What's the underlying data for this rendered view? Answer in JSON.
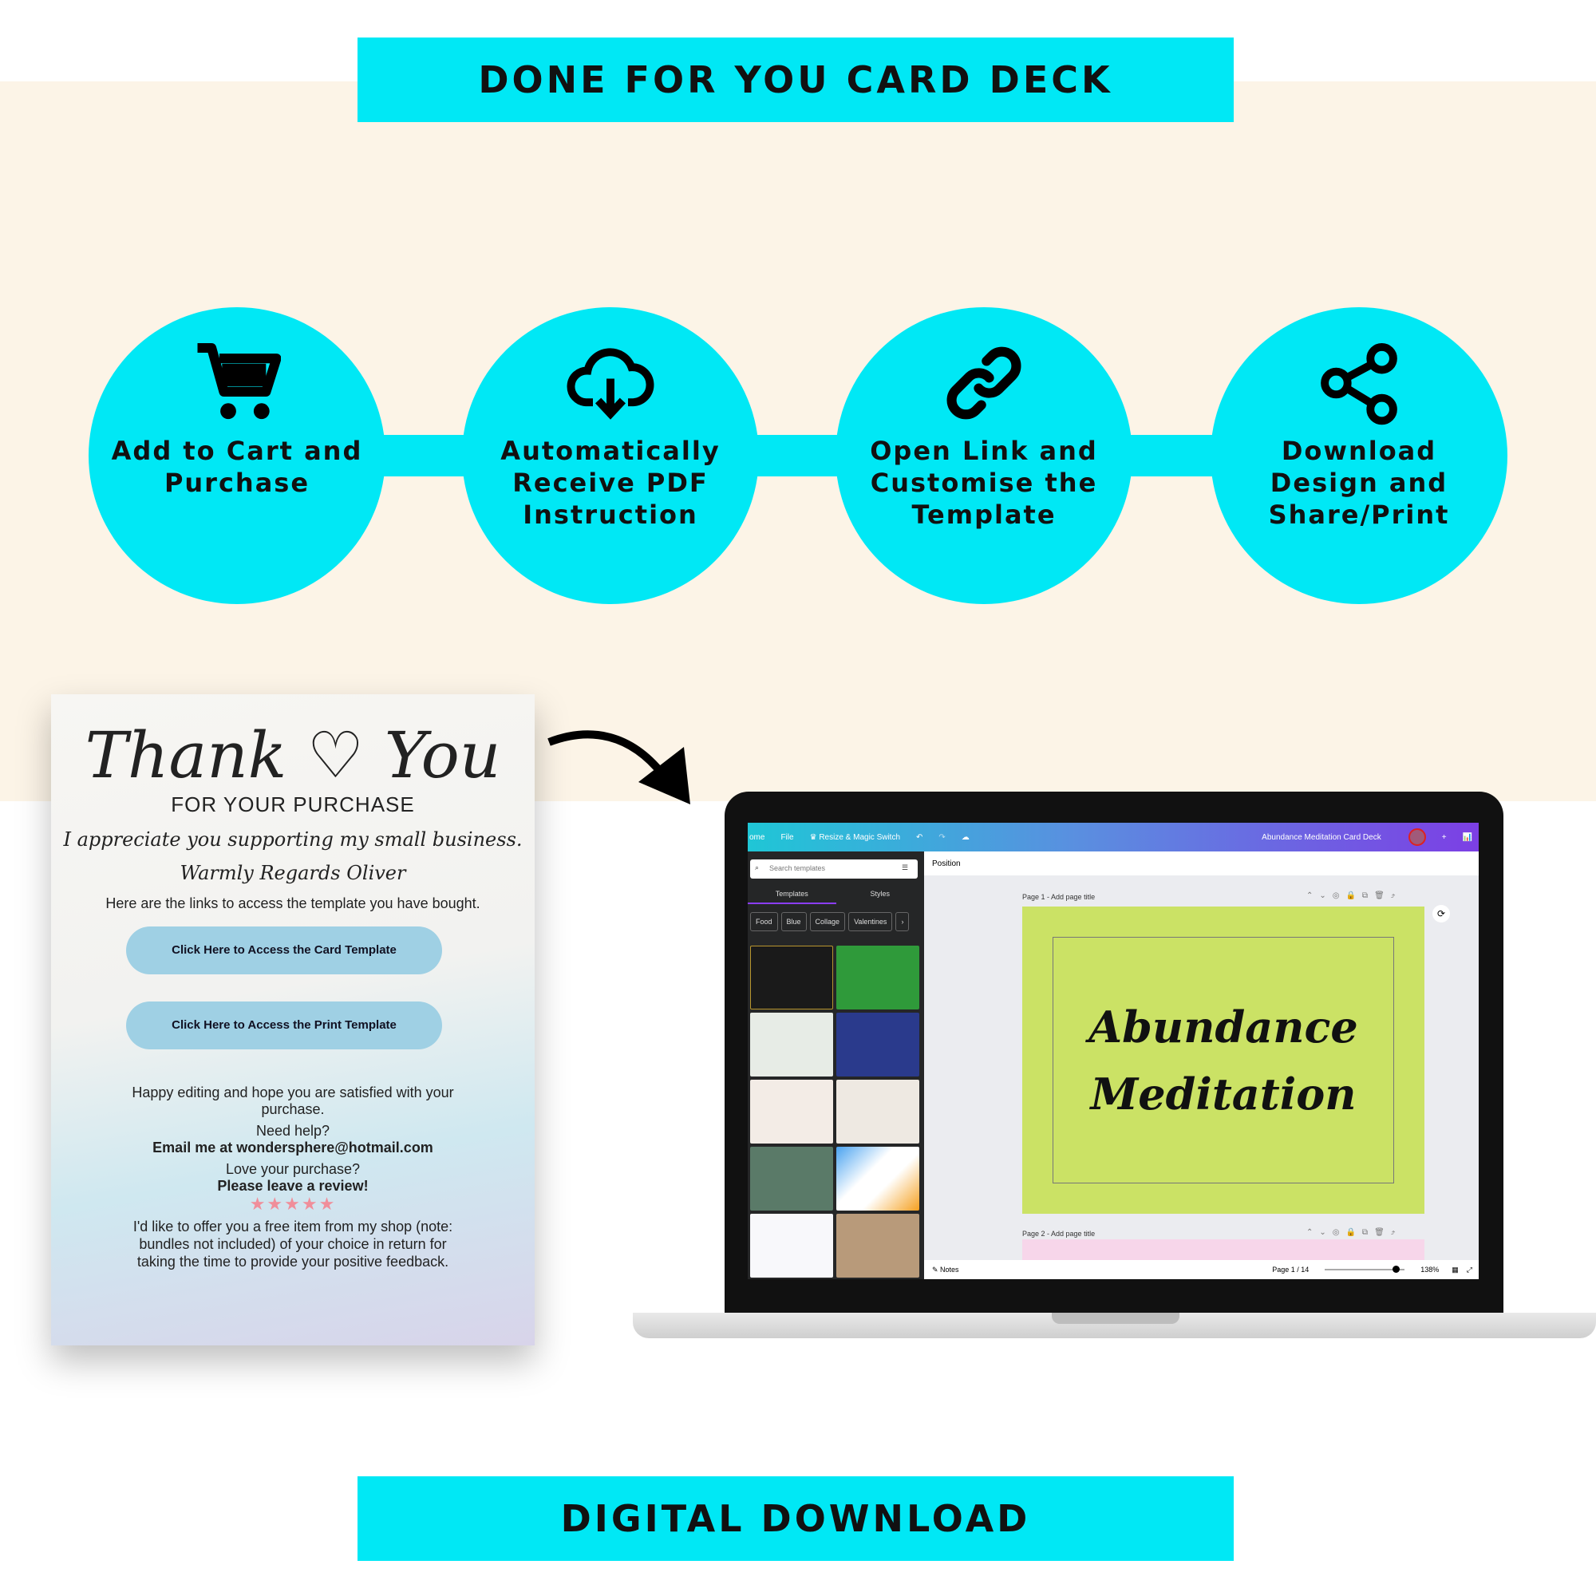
{
  "header": {
    "title": "DONE FOR YOU CARD DECK"
  },
  "steps": [
    {
      "icon": "cart-icon",
      "label": "Add to Cart and Purchase"
    },
    {
      "icon": "cloud-download-icon",
      "label": "Automatically Receive PDF Instruction"
    },
    {
      "icon": "link-icon",
      "label": "Open Link and Customise the Template"
    },
    {
      "icon": "share-icon",
      "label": "Download Design and Share/Print"
    }
  ],
  "card": {
    "title": "Thank ♡ You",
    "subtitle": "FOR YOUR PURCHASE",
    "line1": "I appreciate you supporting my small business.",
    "line2": "Warmly Regards Oliver",
    "intro": "Here are the links to access the template you have bought.",
    "button1": "Click Here to Access the Card Template",
    "button2": "Click Here to Access the Print Template",
    "happy": "Happy editing and hope you are satisfied with your purchase.",
    "help": "Need help?",
    "email": "Email me at wondersphere@hotmail.com",
    "love": "Love your purchase?",
    "review": "Please leave a review!",
    "stars": "★★★★★",
    "offer": "I'd like to offer you a free item from my shop (note: bundles not included) of your choice in return for taking the time to provide your positive feedback."
  },
  "editor": {
    "topbar": {
      "home": "ome",
      "file": "File",
      "resize": "♛ Resize & Magic Switch",
      "doc_title": "Abundance Meditation Card Deck"
    },
    "search_placeholder": "Search templates",
    "tabs": [
      "Templates",
      "Styles"
    ],
    "chips": [
      "Food",
      "Blue",
      "Collage",
      "Valentines"
    ],
    "position": "Position",
    "page1_label": "Page 1 - Add page title",
    "page2_label": "Page 2 - Add page title",
    "design_line1": "Abundance",
    "design_line2": "Meditation",
    "notes": "Notes",
    "page_count": "Page 1 / 14",
    "zoom": "138%",
    "zoom_level_percent": 138,
    "page_color": "#cbe265"
  },
  "footer": {
    "title": "DIGITAL DOWNLOAD"
  },
  "colors": {
    "accent": "#00e8f5",
    "cream": "#fcf4e7"
  }
}
